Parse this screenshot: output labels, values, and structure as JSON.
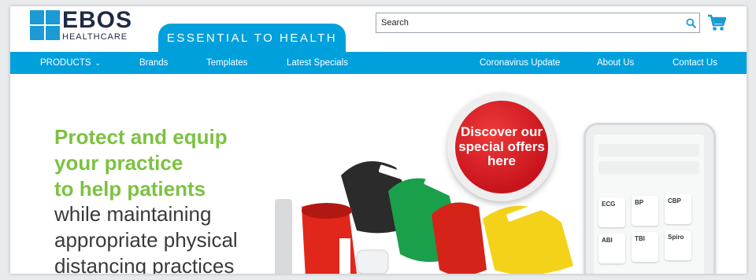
{
  "header": {
    "logo_text": "EBOS",
    "logo_subtext": "HEALTHCARE",
    "tagline": "ESSENTIAL TO HEALTH",
    "search_placeholder": "Search"
  },
  "nav": {
    "items": [
      {
        "label": "PRODUCTS",
        "has_dropdown": true
      },
      {
        "label": "Brands"
      },
      {
        "label": "Templates"
      },
      {
        "label": "Latest Specials"
      },
      {
        "label": "Coronavirus Update"
      },
      {
        "label": "About Us"
      },
      {
        "label": "Contact Us"
      }
    ]
  },
  "hero": {
    "line1": "Protect and equip",
    "line2": "your practice",
    "line3": "to help patients",
    "line4": "while maintaining",
    "line5": "appropriate physical",
    "line6": "distancing practices",
    "badge": "Discover our special offers here"
  },
  "tablet": {
    "tiles": [
      "ECG",
      "BP",
      "CBP",
      "ABI",
      "TBI",
      "Spiro"
    ]
  },
  "colors": {
    "brand_blue": "#00a0dc",
    "green": "#7cc242",
    "badge_red": "#d41e26",
    "dark_navy": "#1f2a44"
  }
}
